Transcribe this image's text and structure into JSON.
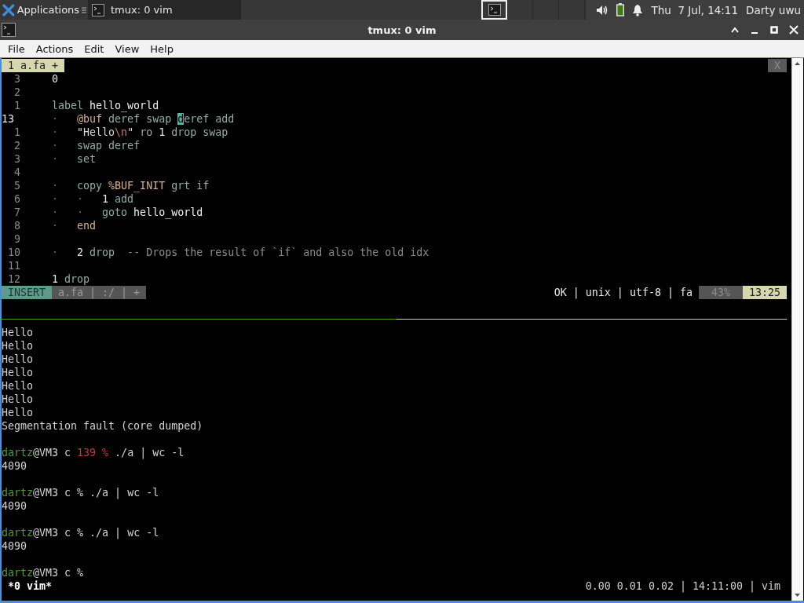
{
  "panel": {
    "menu_label": "Applications",
    "tasks": [
      {
        "title": "tmux: 0 vim",
        "selected": true
      }
    ],
    "workspaces": [
      {
        "selected": true,
        "occupied": true
      },
      {
        "selected": false,
        "occupied": false
      },
      {
        "selected": false,
        "occupied": false
      },
      {
        "selected": false,
        "occupied": false
      }
    ],
    "clock": "Thu  7 Jul, 14:11",
    "user": "Darty uwu"
  },
  "window": {
    "title": "tmux: 0 vim"
  },
  "menu": [
    "File",
    "Actions",
    "Edit",
    "View",
    "Help"
  ],
  "vim": {
    "tabs": [
      {
        "label": "1 a.fa +",
        "selected": true
      }
    ],
    "close_label": "X",
    "lines": [
      {
        "number": "3",
        "current": false,
        "segments": [
          {
            "text": "0",
            "kind": "number"
          }
        ]
      },
      {
        "number": "2",
        "current": false
      },
      {
        "number": "1",
        "current": false,
        "segments": [
          {
            "text": "label ",
            "kind": "keyword"
          },
          {
            "text": "hello_world",
            "kind": "name"
          }
        ]
      },
      {
        "number": "13",
        "current": true,
        "segments": [
          {
            "text": "·   ",
            "kind": "indent"
          },
          {
            "text": "@buf",
            "kind": "constant"
          },
          {
            "text": " deref swap ",
            "kind": "keyword"
          },
          {
            "text": "d",
            "kind": "cursor"
          },
          {
            "text": "eref add",
            "kind": "keyword"
          }
        ]
      },
      {
        "number": "1",
        "current": false,
        "segments": [
          {
            "text": "·   ",
            "kind": "indent"
          },
          {
            "text": "\"Hello",
            "kind": "string"
          },
          {
            "text": "\\n",
            "kind": "escape"
          },
          {
            "text": "\"",
            "kind": "string"
          },
          {
            "text": " ro ",
            "kind": "keyword"
          },
          {
            "text": "1",
            "kind": "number"
          },
          {
            "text": " drop swap",
            "kind": "keyword"
          }
        ]
      },
      {
        "number": "2",
        "current": false,
        "segments": [
          {
            "text": "·   ",
            "kind": "indent"
          },
          {
            "text": "swap deref",
            "kind": "keyword"
          }
        ]
      },
      {
        "number": "3",
        "current": false,
        "segments": [
          {
            "text": "·   ",
            "kind": "indent"
          },
          {
            "text": "set",
            "kind": "keyword"
          }
        ]
      },
      {
        "number": "4",
        "current": false
      },
      {
        "number": "5",
        "current": false,
        "segments": [
          {
            "text": "·   ",
            "kind": "indent"
          },
          {
            "text": "copy ",
            "kind": "keyword"
          },
          {
            "text": "%BUF_INIT",
            "kind": "constant"
          },
          {
            "text": " grt if",
            "kind": "keyword"
          }
        ]
      },
      {
        "number": "6",
        "current": false,
        "segments": [
          {
            "text": "·   ·   ",
            "kind": "indent"
          },
          {
            "text": "1",
            "kind": "number"
          },
          {
            "text": " add",
            "kind": "keyword"
          }
        ]
      },
      {
        "number": "7",
        "current": false,
        "segments": [
          {
            "text": "·   ·   ",
            "kind": "indent"
          },
          {
            "text": "goto ",
            "kind": "keyword"
          },
          {
            "text": "hello_world",
            "kind": "name"
          }
        ]
      },
      {
        "number": "8",
        "current": false,
        "segments": [
          {
            "text": "·   ",
            "kind": "indent"
          },
          {
            "text": "end",
            "kind": "constant"
          }
        ]
      },
      {
        "number": "9",
        "current": false
      },
      {
        "number": "10",
        "current": false,
        "segments": [
          {
            "text": "·   ",
            "kind": "indent"
          },
          {
            "text": "2",
            "kind": "number"
          },
          {
            "text": " drop",
            "kind": "keyword"
          },
          {
            "text": "  -- Drops the result of `if` and also the old idx",
            "kind": "comment"
          }
        ]
      },
      {
        "number": "11",
        "current": false
      },
      {
        "number": "12",
        "current": false,
        "segments": [
          {
            "text": "1",
            "kind": "number"
          },
          {
            "text": " drop",
            "kind": "keyword"
          }
        ]
      }
    ],
    "status": {
      "mode": "INSERT",
      "file": "a.fa | :/ | +",
      "info": "OK | unix | utf-8 | fa",
      "percent": "43%",
      "position": "13:25"
    }
  },
  "shell": {
    "lines": [
      {
        "kind": "output",
        "text": "Hello"
      },
      {
        "kind": "output",
        "text": "Hello"
      },
      {
        "kind": "output",
        "text": "Hello"
      },
      {
        "kind": "output",
        "text": "Hello"
      },
      {
        "kind": "output",
        "text": "Hello"
      },
      {
        "kind": "output",
        "text": "Hello"
      },
      {
        "kind": "output",
        "text": "Hello"
      },
      {
        "kind": "output",
        "text": "Segmentation fault (core dumped)"
      },
      {
        "kind": "prompt",
        "user": "dartz",
        "host": "@VM3 c",
        "exit_code": "139",
        "symbol": "%",
        "command": "./a | wc -l"
      },
      {
        "kind": "output",
        "text": "4090"
      },
      {
        "kind": "prompt",
        "user": "dartz",
        "host": "@VM3 c",
        "symbol": "%",
        "command": "./a | wc -l"
      },
      {
        "kind": "output",
        "text": "4090"
      },
      {
        "kind": "prompt",
        "user": "dartz",
        "host": "@VM3 c",
        "symbol": "%",
        "command": "./a | wc -l"
      },
      {
        "kind": "output",
        "text": "4090"
      },
      {
        "kind": "prompt",
        "user": "dartz",
        "host": "@VM3 c",
        "symbol": "%"
      }
    ]
  },
  "tmux": {
    "windows": [
      {
        "label": "*0 vim*",
        "selected": true
      }
    ],
    "status_right": "0.00 0.01 0.02 | 14:11:00 | vim"
  }
}
